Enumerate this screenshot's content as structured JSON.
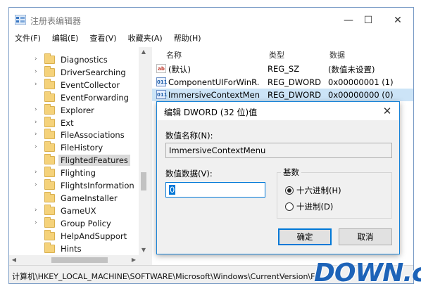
{
  "window": {
    "title": "注册表编辑器",
    "controls": {
      "minimize": "—",
      "maximize": "☐",
      "close": "✕"
    }
  },
  "menu": [
    "文件(F)",
    "编辑(E)",
    "查看(V)",
    "收藏夹(A)",
    "帮助(H)"
  ],
  "tree": {
    "items": [
      {
        "label": "Diagnostics",
        "expandable": true
      },
      {
        "label": "DriverSearching",
        "expandable": true
      },
      {
        "label": "EventCollector",
        "expandable": true
      },
      {
        "label": "EventForwarding",
        "expandable": false
      },
      {
        "label": "Explorer",
        "expandable": true
      },
      {
        "label": "Ext",
        "expandable": true
      },
      {
        "label": "FileAssociations",
        "expandable": true
      },
      {
        "label": "FileHistory",
        "expandable": true
      },
      {
        "label": "FlightedFeatures",
        "expandable": false,
        "selected": true
      },
      {
        "label": "Flighting",
        "expandable": true
      },
      {
        "label": "FlightsInformation",
        "expandable": true
      },
      {
        "label": "GameInstaller",
        "expandable": false
      },
      {
        "label": "GameUX",
        "expandable": true
      },
      {
        "label": "Group Policy",
        "expandable": true
      },
      {
        "label": "HelpAndSupport",
        "expandable": false
      },
      {
        "label": "Hints",
        "expandable": false
      }
    ]
  },
  "list": {
    "headers": {
      "name": "名称",
      "type": "类型",
      "data": "数据"
    },
    "rows": [
      {
        "icon": "ab",
        "name": "(默认)",
        "type": "REG_SZ",
        "data": "(数值未设置)"
      },
      {
        "icon": "dw",
        "name": "ComponentUIForWinR...",
        "type": "REG_DWORD",
        "data": "0x00000001 (1)"
      },
      {
        "icon": "dw",
        "name": "ImmersiveContextMenu",
        "type": "REG_DWORD",
        "data": "0x00000000 (0)",
        "selected": true
      }
    ]
  },
  "status_path": "计算机\\HKEY_LOCAL_MACHINE\\SOFTWARE\\Microsoft\\Windows\\CurrentVersion\\Fli",
  "dialog": {
    "title": "编辑 DWORD (32 位)值",
    "close": "✕",
    "value_name_label": "数值名称(N):",
    "value_name": "ImmersiveContextMenu",
    "value_data_label": "数值数据(V):",
    "value_data": "0",
    "base_label": "基数",
    "radio_hex": "十六进制(H)",
    "radio_dec": "十进制(D)",
    "base_selected": "hex",
    "ok": "确定",
    "cancel": "取消"
  },
  "watermark": "DOWN.cc",
  "colors": {
    "accent": "#0078d7",
    "selection": "#cce4f7",
    "folder": "#f5d27a",
    "watermark": "#1d63b8"
  }
}
